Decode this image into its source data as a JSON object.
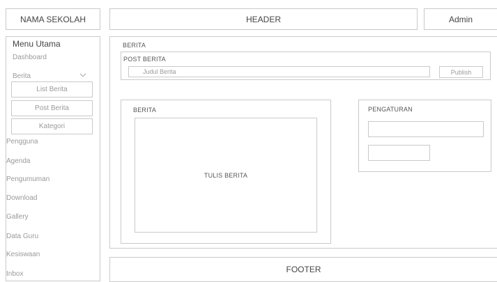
{
  "header": {
    "logo": "NAMA SEKOLAH",
    "title": "HEADER",
    "user": "Admin"
  },
  "sidebar": {
    "title": "Menu Utama",
    "items": [
      {
        "label": "Dashboard"
      },
      {
        "label": "Berita",
        "expanded": true,
        "icon": "chevron-down-icon",
        "children": [
          {
            "label": "List Berita"
          },
          {
            "label": "Post Berita"
          },
          {
            "label": "Kategori"
          }
        ]
      },
      {
        "label": "Pengguna"
      },
      {
        "label": "Agenda"
      },
      {
        "label": "Pengumuman"
      },
      {
        "label": "Download"
      },
      {
        "label": "Gallery"
      },
      {
        "label": "Data Guru"
      },
      {
        "label": "Kesiswaan"
      },
      {
        "label": "Inbox"
      }
    ]
  },
  "main": {
    "section_title": "BERITA",
    "post": {
      "title": "POST BERITA",
      "title_placeholder": "Judul Berita",
      "publish_label": "Publish"
    },
    "editor": {
      "title": "BERITA",
      "body_placeholder": "TULIS BERITA"
    },
    "settings": {
      "title": "PENGATURAN"
    }
  },
  "footer": {
    "label": "FOOTER"
  }
}
